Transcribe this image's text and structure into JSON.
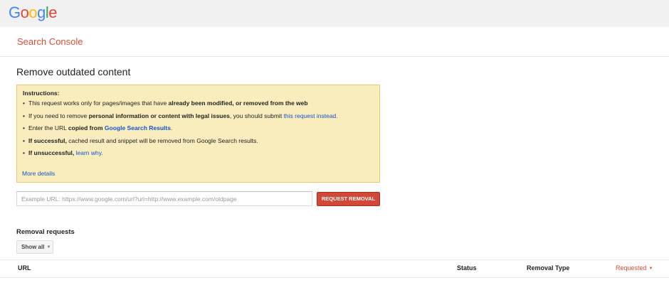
{
  "header": {
    "logo_letters": [
      {
        "ch": "G",
        "color": "#4285f4"
      },
      {
        "ch": "o",
        "color": "#ea4335"
      },
      {
        "ch": "o",
        "color": "#fbbc05"
      },
      {
        "ch": "g",
        "color": "#4285f4"
      },
      {
        "ch": "l",
        "color": "#34a853"
      },
      {
        "ch": "e",
        "color": "#ea4335"
      }
    ],
    "app_title": "Search Console"
  },
  "main": {
    "page_title": "Remove outdated content",
    "instructions": {
      "title": "Instructions:",
      "item1": {
        "text": "This request works only for pages/images that have ",
        "bold": "already been modified, or removed from the web"
      },
      "item2": {
        "text1": "If you need to remove ",
        "bold": "personal information or content with legal issues",
        "text2": ", you should submit ",
        "link": "this request instead."
      },
      "item3": {
        "text1": "Enter the URL ",
        "bold": "copied from ",
        "link": "Google Search Results",
        "text2": "."
      },
      "item4": {
        "bold": "If successful,",
        "text": " cached result and snippet will be removed from Google Search results."
      },
      "item5": {
        "bold": "If unsuccessful,",
        "link": "learn why."
      },
      "more_details": "More details"
    },
    "url_input": {
      "placeholder": "Example URL: https://www.google.com/url?url=http://www.example.com/oldpage",
      "value": ""
    },
    "request_button": "REQUEST REMOVAL",
    "removal_requests": {
      "title": "Removal requests",
      "filter_label": "Show all",
      "columns": [
        "URL",
        "Status",
        "Removal Type",
        "Requested"
      ],
      "rows": []
    }
  },
  "colors": {
    "brand_red": "#dd4b39",
    "button_red": "#d14836",
    "notice_bg": "#f9edbe",
    "link": "#1155cc"
  }
}
